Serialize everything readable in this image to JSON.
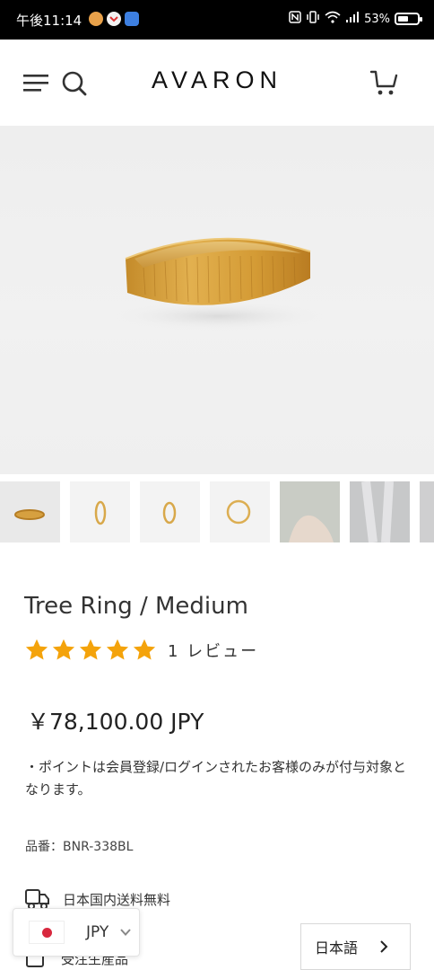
{
  "status_bar": {
    "time": "午後11:14",
    "battery": "53%",
    "battery_level": 0.53
  },
  "header": {
    "logo": "AVARON",
    "icons": [
      "menu-icon",
      "search-icon",
      "cart-icon"
    ]
  },
  "gallery": {
    "thumbnail_count": 7,
    "active_index": 0
  },
  "product": {
    "title": "Tree Ring / Medium",
    "rating": 5,
    "review_count": "1 レビュー",
    "price": "￥78,100.00 JPY",
    "note": "・ポイントは会員登録/ログインされたお客様のみが付与対象となります。",
    "sku": "品番：BNR-338BL",
    "shipping": "日本国内送料無料",
    "made_to_order": "受注生産品"
  },
  "selectors": {
    "currency": "JPY",
    "language": "日本語"
  },
  "colors": {
    "star": "#f4a30b",
    "ring_gold": "#d9a53f",
    "flag_red": "#d8283e"
  }
}
